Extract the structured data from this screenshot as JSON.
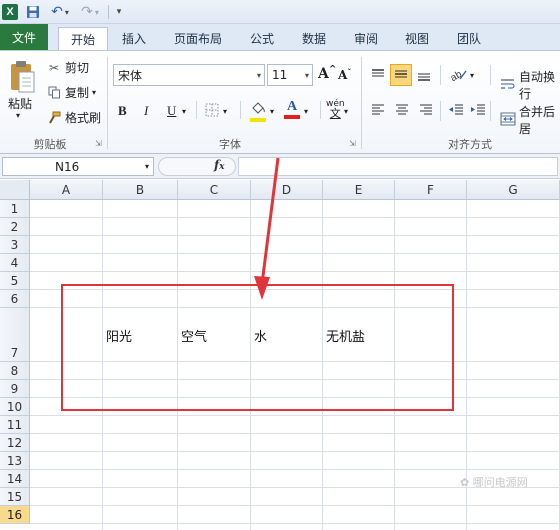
{
  "window": {
    "app_icon": "X"
  },
  "tabs": {
    "file": "文件",
    "items": [
      "开始",
      "插入",
      "页面布局",
      "公式",
      "数据",
      "审阅",
      "视图",
      "团队"
    ]
  },
  "ribbon": {
    "clipboard": {
      "paste": "粘贴",
      "cut": "剪切",
      "copy": "复制",
      "format_painter": "格式刷",
      "label": "剪贴板"
    },
    "font": {
      "name": "宋体",
      "size": "11",
      "bold": "B",
      "italic": "I",
      "underline": "U",
      "phonetic": "wén",
      "label": "字体",
      "grow": "A",
      "shrink": "A"
    },
    "alignment": {
      "wrap_text": "自动换行",
      "merge_center": "合并后居",
      "label": "对齐方式"
    }
  },
  "formula_bar": {
    "name_box": "N16",
    "fx": "fx",
    "value": ""
  },
  "sheet": {
    "columns": [
      "A",
      "B",
      "C",
      "D",
      "E",
      "F",
      "G"
    ],
    "rows": [
      "1",
      "2",
      "3",
      "4",
      "5",
      "6",
      "7",
      "8",
      "9",
      "10",
      "11",
      "12",
      "13",
      "14",
      "15",
      "16"
    ],
    "selected_row": "16",
    "row7_cells": [
      {
        "col": "B",
        "text": "阳光"
      },
      {
        "col": "C",
        "text": "空气"
      },
      {
        "col": "D",
        "text": "水"
      },
      {
        "col": "E",
        "text": "无机盐"
      }
    ]
  },
  "annotation": {
    "box_color": "#e0353b"
  },
  "colors": {
    "file_tab": "#2a7a3f",
    "selected_row": "#f9d98c",
    "accent": "#2b5fb0"
  }
}
